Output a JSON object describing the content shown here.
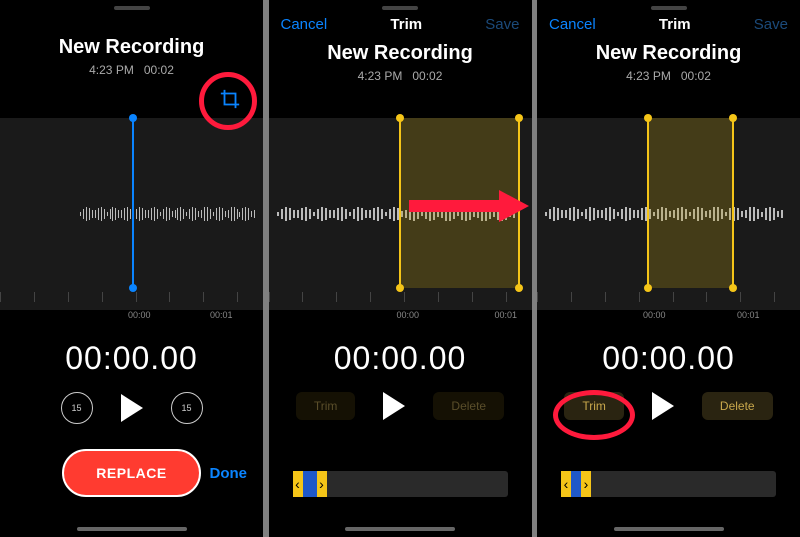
{
  "screen1": {
    "title": "New Recording",
    "time": "4:23 PM",
    "duration": "00:02",
    "ticks": [
      "00:00",
      "00:01"
    ],
    "big_time": "00:00.00",
    "skip_back": "15",
    "skip_fwd": "15",
    "replace": "REPLACE",
    "done": "Done"
  },
  "screen2": {
    "cancel": "Cancel",
    "header": "Trim",
    "save": "Save",
    "title": "New Recording",
    "time": "4:23 PM",
    "duration": "00:02",
    "ticks": [
      "00:00",
      "00:01"
    ],
    "big_time": "00:00.00",
    "trim": "Trim",
    "delete": "Delete"
  },
  "screen3": {
    "cancel": "Cancel",
    "header": "Trim",
    "save": "Save",
    "title": "New Recording",
    "time": "4:23 PM",
    "duration": "00:02",
    "ticks": [
      "00:00",
      "00:01"
    ],
    "big_time": "00:00.00",
    "trim": "Trim",
    "delete": "Delete"
  },
  "colors": {
    "accent_blue": "#0a84ff",
    "accent_yellow": "#f5c518",
    "accent_red": "#ff3b30",
    "annotation_red": "#ff1a3c"
  }
}
